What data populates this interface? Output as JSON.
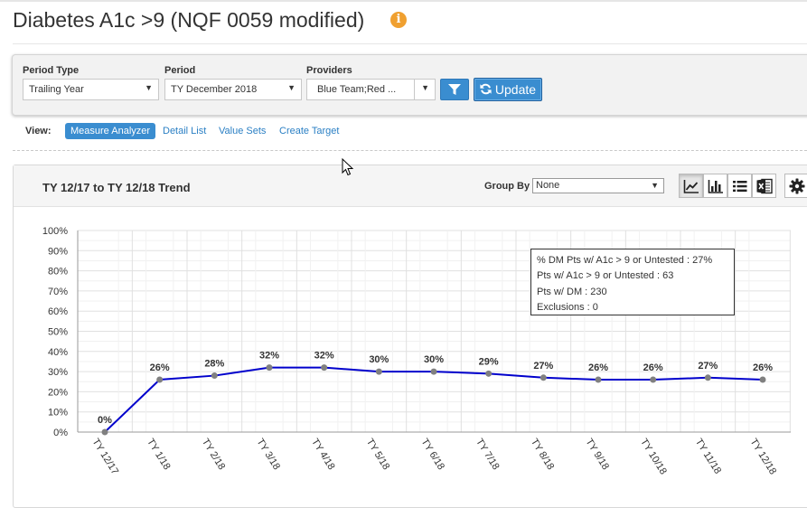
{
  "page": {
    "title": "Diabetes A1c >9 (NQF 0059 modified)",
    "info_icon": "info-icon"
  },
  "filters": {
    "period_type_label": "Period Type",
    "period_type_value": "Trailing Year",
    "period_label": "Period",
    "period_value": "TY December 2018",
    "providers_label": "Providers",
    "providers_value": "Blue Team;Red ...",
    "filter_button_icon": "filter-icon",
    "update_label": "Update",
    "update_icon": "refresh-icon"
  },
  "view": {
    "label": "View:",
    "tabs": [
      "Measure Analyzer",
      "Detail List",
      "Value Sets",
      "Create Target"
    ],
    "active": "Measure Analyzer"
  },
  "chart_panel": {
    "title": "TY 12/17 to TY 12/18 Trend",
    "group_by_label": "Group By",
    "group_by_value": "None",
    "view_buttons": [
      "line-chart-icon",
      "bar-chart-icon",
      "list-icon",
      "excel-icon",
      "gear-icon"
    ],
    "active_view": "line-chart-icon"
  },
  "tooltip": {
    "lines": [
      "% DM Pts w/ A1c > 9 or Untested : 27%",
      "Pts w/ A1c > 9 or Untested : 63",
      "Pts w/ DM : 230",
      "Exclusions : 0"
    ]
  },
  "colors": {
    "accent": "#3a8dd0",
    "series_line": "#0000cc",
    "point": "#808080",
    "info": "#f0a030"
  },
  "chart_data": {
    "type": "line",
    "categories": [
      "TY 12/17",
      "TY 1/18",
      "TY 2/18",
      "TY 3/18",
      "TY 4/18",
      "TY 5/18",
      "TY 6/18",
      "TY 7/18",
      "TY 8/18",
      "TY 9/18",
      "TY 10/18",
      "TY 11/18",
      "TY 12/18"
    ],
    "series": [
      {
        "values": [
          0,
          26,
          28,
          32,
          32,
          30,
          30,
          29,
          27,
          26,
          26,
          27,
          26
        ]
      }
    ],
    "data_labels": [
      "0%",
      "26%",
      "28%",
      "32%",
      "32%",
      "30%",
      "30%",
      "29%",
      "27%",
      "26%",
      "26%",
      "27%",
      "26%"
    ],
    "y_ticks": [
      "0%",
      "10%",
      "20%",
      "30%",
      "40%",
      "50%",
      "60%",
      "70%",
      "80%",
      "90%",
      "100%"
    ],
    "ylim": [
      0,
      100
    ],
    "grid": true,
    "legend": "none"
  }
}
